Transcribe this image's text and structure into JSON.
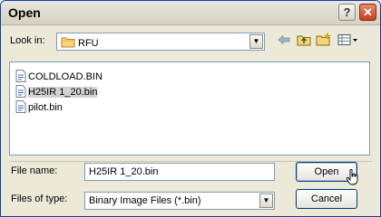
{
  "window": {
    "title": "Open",
    "help_label": "?",
    "close_label": "✕"
  },
  "look_in": {
    "label": "Look in:",
    "value": "RFU"
  },
  "toolbar": {
    "icons": [
      "back-arrow-icon",
      "up-folder-icon",
      "new-folder-icon",
      "view-menu-icon"
    ]
  },
  "files": [
    {
      "name": "COLDLOAD.BIN"
    },
    {
      "name": "H25IR 1_20.bin"
    },
    {
      "name": "pilot.bin"
    }
  ],
  "file_name": {
    "label": "File name:",
    "value": "H25IR 1_20.bin"
  },
  "file_type": {
    "label": "Files of type:",
    "value": "Binary Image Files (*.bin)"
  },
  "buttons": {
    "open": "Open",
    "cancel": "Cancel"
  }
}
